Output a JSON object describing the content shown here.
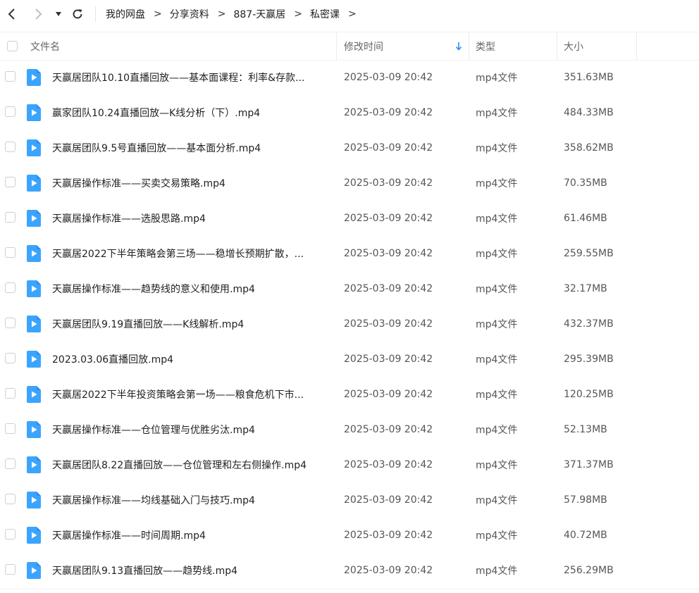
{
  "nav": {
    "breadcrumb": [
      "我的网盘",
      "分享资料",
      "887-天赢居",
      "私密课"
    ],
    "separator": ">"
  },
  "columns": {
    "name": "文件名",
    "modified": "修改时间",
    "type": "类型",
    "size": "大小",
    "sort_indicator_color": "#2b8ef0"
  },
  "colors": {
    "icon_blue": "#3aa4ff",
    "icon_blue_dark": "#2b8ef0"
  },
  "files": [
    {
      "name": "天赢居团队10.10直播回放——基本面课程：利率&存款...",
      "modified": "2025-03-09 20:42",
      "type": "mp4文件",
      "size": "351.63MB"
    },
    {
      "name": "赢家团队10.24直播回放—K线分析（下）.mp4",
      "modified": "2025-03-09 20:42",
      "type": "mp4文件",
      "size": "484.33MB"
    },
    {
      "name": "天赢居团队9.5号直播回放——基本面分析.mp4",
      "modified": "2025-03-09 20:42",
      "type": "mp4文件",
      "size": "358.62MB"
    },
    {
      "name": "天赢居操作标准——买卖交易策略.mp4",
      "modified": "2025-03-09 20:42",
      "type": "mp4文件",
      "size": "70.35MB"
    },
    {
      "name": "天赢居操作标准——选股思路.mp4",
      "modified": "2025-03-09 20:42",
      "type": "mp4文件",
      "size": "61.46MB"
    },
    {
      "name": "天赢居2022下半年策略会第三场——稳增长预期扩散，...",
      "modified": "2025-03-09 20:42",
      "type": "mp4文件",
      "size": "259.55MB"
    },
    {
      "name": "天赢居操作标准——趋势线的意义和使用.mp4",
      "modified": "2025-03-09 20:42",
      "type": "mp4文件",
      "size": "32.17MB"
    },
    {
      "name": "天赢居团队9.19直播回放——K线解析.mp4",
      "modified": "2025-03-09 20:42",
      "type": "mp4文件",
      "size": "432.37MB"
    },
    {
      "name": "2023.03.06直播回放.mp4",
      "modified": "2025-03-09 20:42",
      "type": "mp4文件",
      "size": "295.39MB"
    },
    {
      "name": "天赢居2022下半年投资策略会第一场——粮食危机下市...",
      "modified": "2025-03-09 20:42",
      "type": "mp4文件",
      "size": "120.25MB"
    },
    {
      "name": "天赢居操作标准——仓位管理与优胜劣汰.mp4",
      "modified": "2025-03-09 20:42",
      "type": "mp4文件",
      "size": "52.13MB"
    },
    {
      "name": "天赢居团队8.22直播回放——仓位管理和左右侧操作.mp4",
      "modified": "2025-03-09 20:42",
      "type": "mp4文件",
      "size": "371.37MB"
    },
    {
      "name": "天赢居操作标准——均线基础入门与技巧.mp4",
      "modified": "2025-03-09 20:42",
      "type": "mp4文件",
      "size": "57.98MB"
    },
    {
      "name": "天赢居操作标准——时间周期.mp4",
      "modified": "2025-03-09 20:42",
      "type": "mp4文件",
      "size": "40.72MB"
    },
    {
      "name": "天赢居团队9.13直播回放——趋势线.mp4",
      "modified": "2025-03-09 20:42",
      "type": "mp4文件",
      "size": "256.29MB"
    }
  ]
}
